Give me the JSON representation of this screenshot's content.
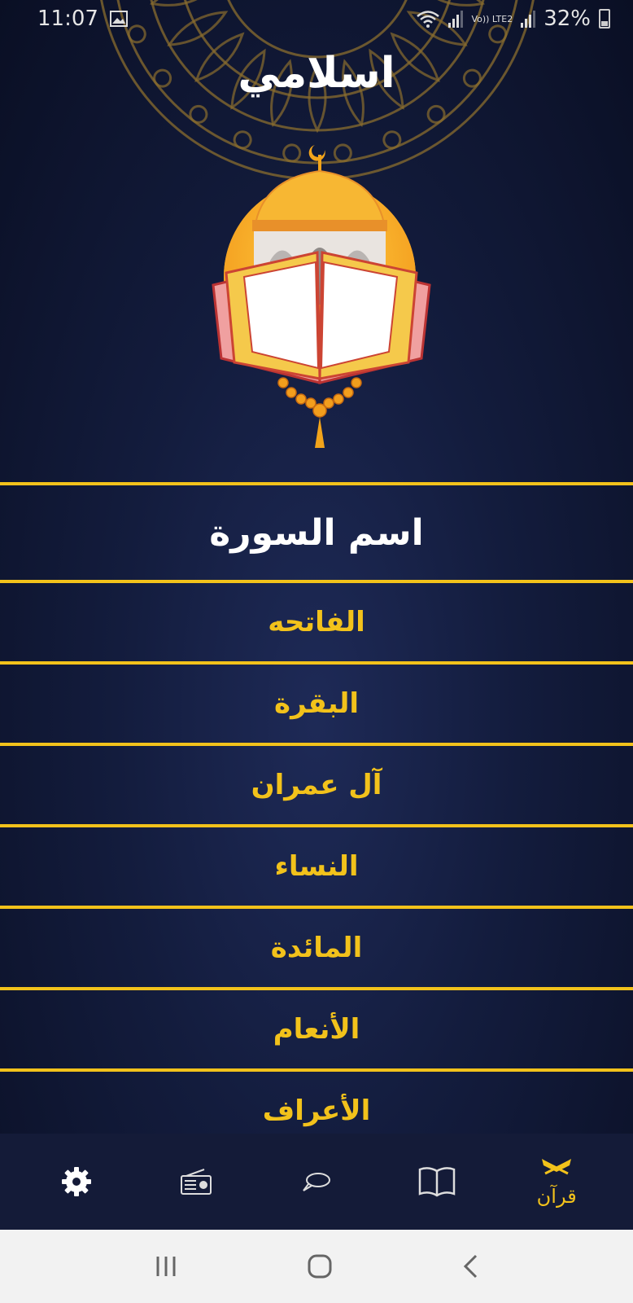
{
  "status_bar": {
    "time": "11:07",
    "network_label": "Vo)) LTE2",
    "battery": "32%"
  },
  "app": {
    "title": "اسلامي"
  },
  "surah_list": {
    "header": "اسم السورة",
    "items": [
      {
        "name": "الفاتحه"
      },
      {
        "name": "البقرة"
      },
      {
        "name": "آل عمران"
      },
      {
        "name": "النساء"
      },
      {
        "name": "المائدة"
      },
      {
        "name": "الأنعام"
      },
      {
        "name": "الأعراف"
      }
    ]
  },
  "bottom_nav": {
    "items": [
      {
        "icon": "gear-icon",
        "label": ""
      },
      {
        "icon": "radio-icon",
        "label": ""
      },
      {
        "icon": "chat-icon",
        "label": ""
      },
      {
        "icon": "open-book-icon",
        "label": ""
      },
      {
        "icon": "quran-icon",
        "label": "قرآن",
        "active": true
      }
    ]
  },
  "colors": {
    "accent": "#f2c21b",
    "background": "#131c3d",
    "nav_background": "#141b38"
  }
}
